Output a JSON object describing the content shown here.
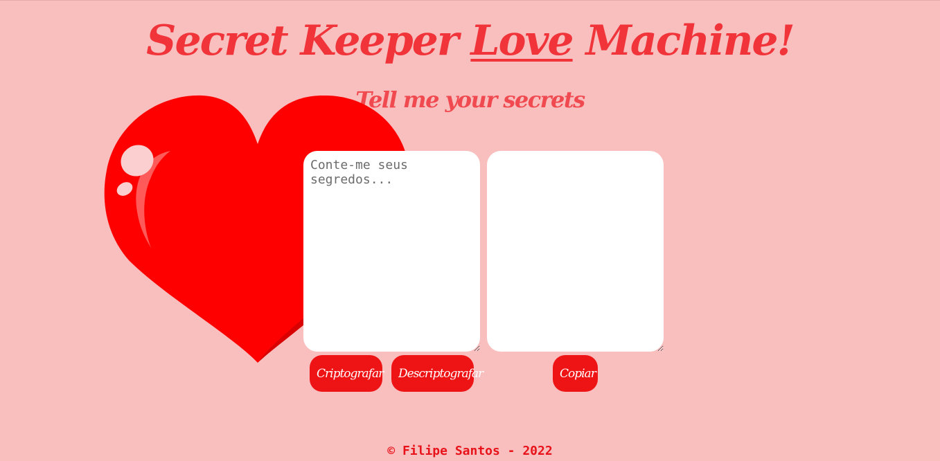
{
  "header": {
    "title_part1": "Secret Keeper ",
    "title_love": "Love",
    "title_part2": " Machine!",
    "subtitle": "Tell me your secrets"
  },
  "input": {
    "placeholder": "Conte-me seus segredos...",
    "value": ""
  },
  "output": {
    "value": ""
  },
  "buttons": {
    "encrypt": "Criptografar",
    "decrypt": "Descriptografar",
    "copy": "Copiar"
  },
  "footer": {
    "text": "© Filipe Santos - 2022"
  },
  "colors": {
    "background": "#f9bfbf",
    "accent": "#ee1416",
    "title": "#f0343a"
  },
  "icons": {
    "decoration": "heart-illustration"
  }
}
